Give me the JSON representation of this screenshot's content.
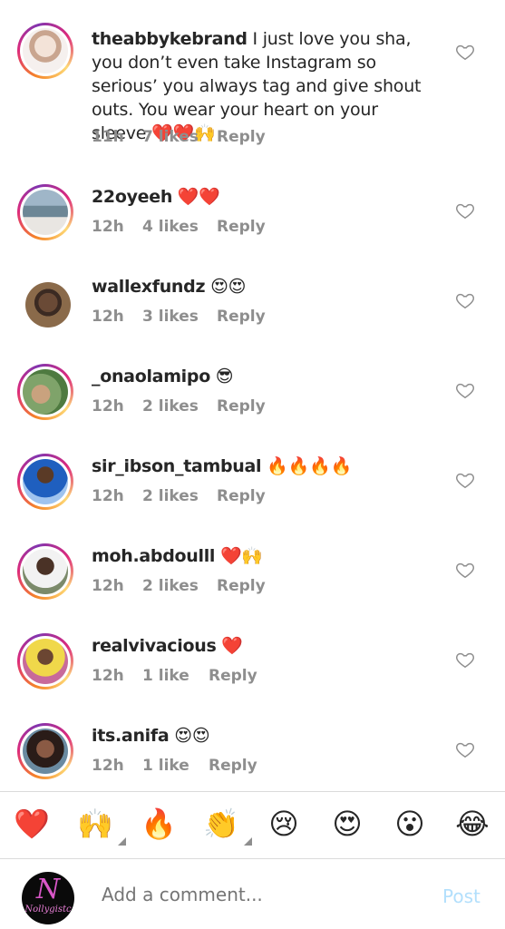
{
  "comments": [
    {
      "username": "theabbykebrand",
      "text": " I just love you sha, you don’t even take Instagram so serious’ you always tag and give shout outs. You wear your heart on your sleeve ❤️❤️🙌",
      "time": "11h",
      "likes": "7 likes",
      "reply": "Reply"
    },
    {
      "username": "22oyeeh",
      "text": " ❤️❤️",
      "time": "12h",
      "likes": "4 likes",
      "reply": "Reply"
    },
    {
      "username": "wallexfundz",
      "text": " 😍😍",
      "time": "12h",
      "likes": "3 likes",
      "reply": "Reply"
    },
    {
      "username": "_onaolamipo",
      "text": " 😎",
      "time": "12h",
      "likes": "2 likes",
      "reply": "Reply"
    },
    {
      "username": "sir_ibson_tambual",
      "text": " 🔥🔥🔥🔥",
      "time": "12h",
      "likes": "2 likes",
      "reply": "Reply"
    },
    {
      "username": "moh.abdoulll",
      "text": " ❤️🙌",
      "time": "12h",
      "likes": "2 likes",
      "reply": "Reply"
    },
    {
      "username": "realvivacious",
      "text": " ❤️",
      "time": "12h",
      "likes": "1 like",
      "reply": "Reply"
    },
    {
      "username": "its.anifa",
      "text": " 😍😍",
      "time": "12h",
      "likes": "1 like",
      "reply": "Reply"
    }
  ],
  "reactions": [
    "❤️",
    "🙌",
    "🔥",
    "👏",
    "😢",
    "😍",
    "😮",
    "😂"
  ],
  "composer": {
    "placeholder": "Add a comment...",
    "post_label": "Post",
    "avatar_logo_letter": "N",
    "avatar_logo_text": "Nollygistc"
  },
  "colors": {
    "meta_gray": "#8e8e8e",
    "post_disabled": "#b2dffc",
    "heart_red": "#ed4956",
    "ring_gradient": [
      "#f58529",
      "#dd2a7b",
      "#8134af"
    ]
  }
}
